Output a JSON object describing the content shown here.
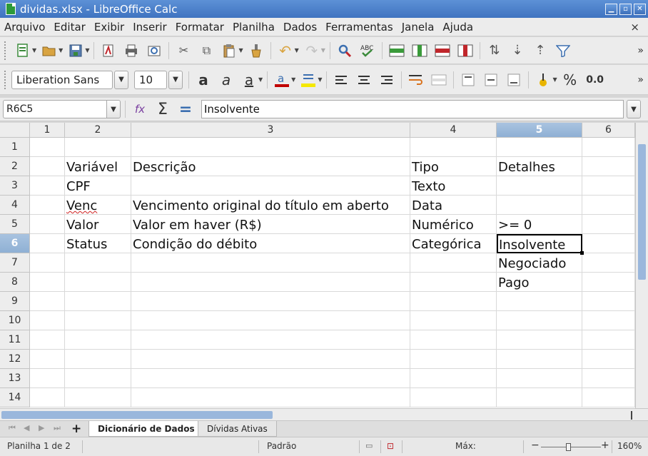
{
  "window": {
    "title": "dividas.xlsx - LibreOffice Calc"
  },
  "menu": [
    "Arquivo",
    "Editar",
    "Exibir",
    "Inserir",
    "Formatar",
    "Planilha",
    "Dados",
    "Ferramentas",
    "Janela",
    "Ajuda"
  ],
  "menu_close": "×",
  "font": {
    "name": "Liberation Sans",
    "size": "10"
  },
  "toolbar_num": {
    "percent": "%",
    "decimal": "0.0"
  },
  "formula_bar": {
    "cell_ref": "R6C5",
    "content": "Insolvente"
  },
  "columns": [
    "1",
    "2",
    "3",
    "4",
    "5",
    "6"
  ],
  "rows": [
    "1",
    "2",
    "3",
    "4",
    "5",
    "6",
    "7",
    "8",
    "9",
    "10",
    "11",
    "12",
    "13",
    "14"
  ],
  "cells": {
    "r2": {
      "c2": "Variável",
      "c3": "Descrição",
      "c4": "Tipo",
      "c5": "Detalhes"
    },
    "r3": {
      "c2": "CPF",
      "c4": "Texto"
    },
    "r4": {
      "c2": "Venc",
      "c3": "Vencimento original do título em aberto",
      "c4": "Data"
    },
    "r5": {
      "c2": "Valor",
      "c3": "Valor em haver (R$)",
      "c4": "Numérico",
      "c5": ">= 0"
    },
    "r6": {
      "c2": "Status",
      "c3": "Condição do débito",
      "c4": "Categórica",
      "c5": "Insolvente"
    },
    "r7": {
      "c5": "Negociado"
    },
    "r8": {
      "c5": "Pago"
    }
  },
  "sheet_tabs": [
    "Dicionário de Dados",
    "Dívidas Ativas"
  ],
  "status": {
    "sheet": "Planilha 1 de 2",
    "style": "Padrão",
    "max": "Máx:",
    "zoom": "160%"
  },
  "colors": {
    "selection_header": "#8fb0d4",
    "title_bar": "#3f73c0",
    "scroll_thumb": "#9ab7dc"
  }
}
